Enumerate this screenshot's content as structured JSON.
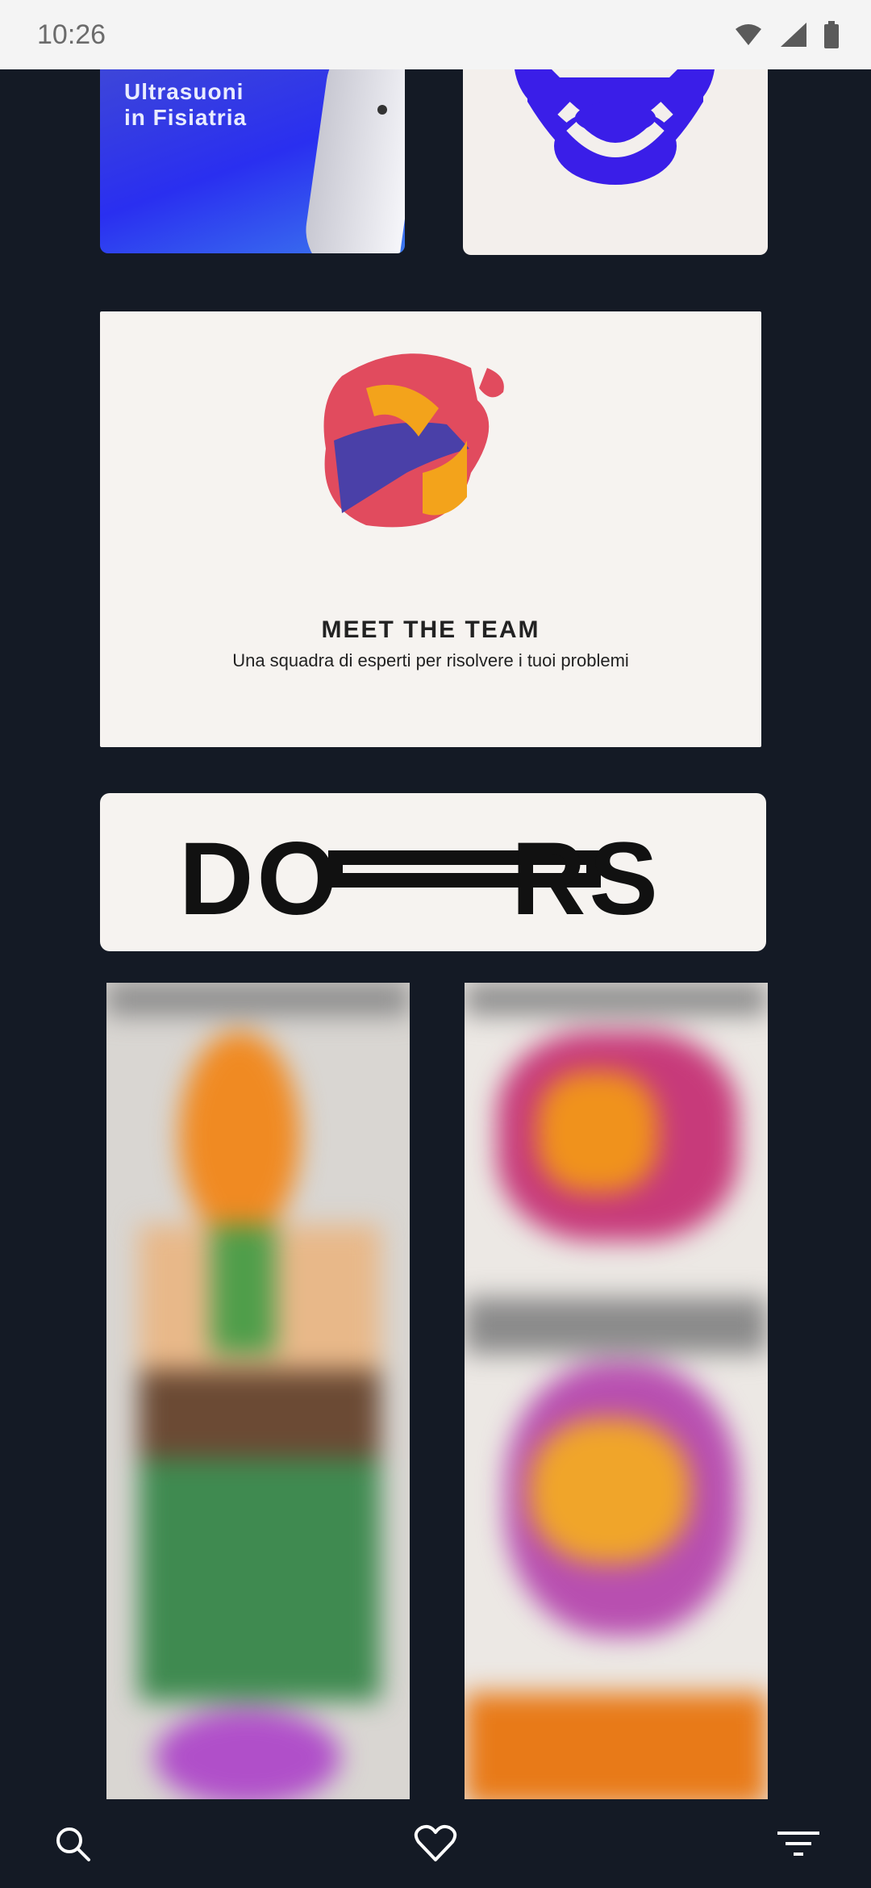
{
  "status_bar": {
    "time": "10:26",
    "icons": [
      "wifi-icon",
      "signal-icon",
      "battery-icon"
    ]
  },
  "feed": {
    "cards": [
      {
        "name": "ultrasound-card",
        "title": "Ultrasuoni\nin Fisiatria"
      },
      {
        "name": "sound-logo-card"
      },
      {
        "name": "meet-team-card",
        "heading": "MEET THE TEAM",
        "subtitle": "Una squadra di esperti per risolvere i tuoi problemi"
      },
      {
        "name": "doors-card",
        "logo_text_left": "DO",
        "logo_text_right": "RS"
      },
      {
        "name": "blurred-card-left"
      },
      {
        "name": "blurred-card-right"
      }
    ]
  },
  "bottom_nav": {
    "items": [
      "search-icon",
      "heart-icon",
      "menu-icon"
    ]
  },
  "colors": {
    "background": "#141a25",
    "status_bar": "#f4f4f4",
    "card_light": "#f6f3f0",
    "accent_blue": "#2a2ff0"
  }
}
